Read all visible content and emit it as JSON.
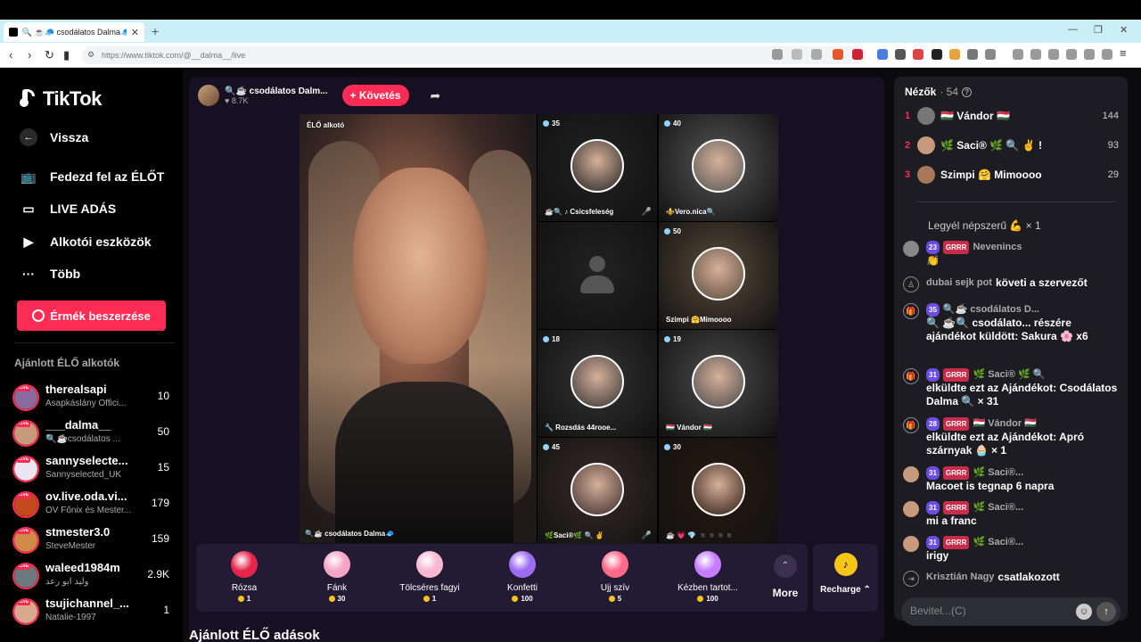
{
  "browser": {
    "tab_title": "🔍 ☕🧢 csodálatos Dalma🧢",
    "tab_close": "✕",
    "new_tab": "+",
    "url": "https://www.tiktok.com/@__dalma__/live",
    "back": "‹",
    "forward": "›",
    "reload": "↻"
  },
  "sidebar": {
    "brand": "TikTok",
    "back_label": "Vissza",
    "nav": [
      {
        "label": "Fedezd fel az ÉLŐT",
        "icon": "explore-live-icon"
      },
      {
        "label": "LIVE ADÁS",
        "icon": "video-camera-icon"
      },
      {
        "label": "Alkotói eszközök",
        "icon": "creator-tools-icon"
      },
      {
        "label": "Több",
        "icon": "more-dots-icon"
      }
    ],
    "coin_button": "Érmék beszerzése",
    "recommended_title": "Ajánlott ÉLŐ alkotók",
    "recommended": [
      {
        "name": "therealsapi",
        "sub": "Asapkáslány Offici...",
        "count": "10",
        "color": "#8a6b9e"
      },
      {
        "name": "___dalma__",
        "sub": "🔍☕csodálatos ...",
        "count": "50",
        "color": "#c79a7c"
      },
      {
        "name": "sannyselecte...",
        "sub": "Sannyselected_UK",
        "count": "15",
        "color": "#e9e6f2"
      },
      {
        "name": "ov.live.oda.vi...",
        "sub": "OV Főnix és Mester...",
        "count": "179",
        "color": "#c24a1c"
      },
      {
        "name": "stmester3.0",
        "sub": "SteveMester",
        "count": "159",
        "color": "#d28a48"
      },
      {
        "name": "waleed1984m",
        "sub": "وليد ابو رعد",
        "count": "2.9K",
        "color": "#6a7a80"
      },
      {
        "name": "tsujichannel_...",
        "sub": "Natalie-1997",
        "count": "1",
        "color": "#d8a98f"
      }
    ]
  },
  "stream": {
    "host_name": "🔍☕ csodálatos Dalm...",
    "host_likes": "♥ 8.7K",
    "follow_label": "+ Követés",
    "main_label_top": "ÉLŐ alkotó",
    "main_label_bottom": "🔍☕ csodálatos Dalma🧢",
    "slots": [
      {
        "count": "35",
        "name": "☕🔍 ♪ Csicsfeleség",
        "bg": "#222"
      },
      {
        "count": "40",
        "name": "⚜️Vero.nica🔍",
        "bg": "#555"
      },
      {
        "count": "",
        "name": "",
        "bg": "#222"
      },
      {
        "count": "50",
        "name": "Szimpi 🤗Mimoooo",
        "bg": "#5a4a3a"
      },
      {
        "count": "18",
        "name": "🔧 Rozsdás 44rooe...",
        "bg": "#333"
      },
      {
        "count": "19",
        "name": "🇭🇺 Vándor 🇭🇺",
        "bg": "#4a4a4a"
      },
      {
        "count": "45",
        "name": "🌿Saci®🌿 🔍 ✌️",
        "bg": "#3a2a2a"
      },
      {
        "count": "30",
        "name": "☕ 💗 💎 ◾◾◾◾",
        "bg": "#2a1a10"
      }
    ]
  },
  "gifts": [
    {
      "name": "Rózsa",
      "price": "1",
      "color": "#e5254a"
    },
    {
      "name": "Fánk",
      "price": "30",
      "color": "#f4a5c5"
    },
    {
      "name": "Tölcséres fagyi",
      "price": "1",
      "color": "#f7b8d0"
    },
    {
      "name": "Konfetti",
      "price": "100",
      "color": "#9b6bf0"
    },
    {
      "name": "Ujj szív",
      "price": "5",
      "color": "#ff6a8a"
    },
    {
      "name": "Kézben tartot...",
      "price": "100",
      "color": "#c77dff"
    }
  ],
  "gift_more": "More",
  "gift_more_arrow": "⌃",
  "recharge": "Recharge ⌃",
  "recommended_live_heading": "Ajánlott ÉLŐ adások",
  "chat": {
    "viewers_label": "Nézők",
    "viewers_count": "· 54",
    "top_viewers": [
      {
        "rank": "1",
        "name": "🇭🇺 Vándor 🇭🇺",
        "score": "144",
        "color": "#777"
      },
      {
        "rank": "2",
        "name": "🌿 Saci® 🌿 🔍 ✌️ !",
        "score": "93",
        "color": "#c79a7c"
      },
      {
        "rank": "3",
        "name": "Szimpi 🤗 Mimoooo",
        "score": "29",
        "color": "#a87858"
      }
    ],
    "banner": "Legyél népszerű 💪 × 1",
    "messages": [
      {
        "level": "23",
        "tag": "GRRR",
        "user": "Nevenincs",
        "text": "👏",
        "color": "#888"
      },
      {
        "level": "",
        "tag": "",
        "user": "dubai sejk pot",
        "text": "követi a szervezőt",
        "color": ""
      },
      {
        "level": "35",
        "tag": "",
        "user": "🔍☕ csodálatos D...",
        "text": "🔍 ☕🔍 csodálato... részére ajándékot küldött: Sakura 🌸 x6",
        "color": ""
      },
      {
        "level": "31",
        "tag": "GRRR",
        "user": "🌿 Saci® 🌿 🔍",
        "text": "elküldte ezt az Ajándékot: Csodálatos Dalma 🔍 × 31",
        "color": ""
      },
      {
        "level": "28",
        "tag": "GRRR",
        "user": "🇭🇺 Vándor 🇭🇺",
        "text": "elküldte ezt az Ajándékot: Apró szárnyak 🧁 × 1",
        "color": ""
      },
      {
        "level": "31",
        "tag": "GRRR",
        "user": "🌿 Saci®...",
        "text": "Macoet is tegnap 6 napra",
        "color": "#c79a7c"
      },
      {
        "level": "31",
        "tag": "GRRR",
        "user": "🌿 Saci®...",
        "text": "mi a franc",
        "color": "#c79a7c"
      },
      {
        "level": "31",
        "tag": "GRRR",
        "user": "🌿 Saci®...",
        "text": "irigy",
        "color": "#c79a7c"
      },
      {
        "level": "",
        "tag": "",
        "user": "Krisztián Nagy",
        "text": "csatlakozott",
        "color": ""
      }
    ],
    "input_placeholder": "Bevitel...(C)"
  }
}
